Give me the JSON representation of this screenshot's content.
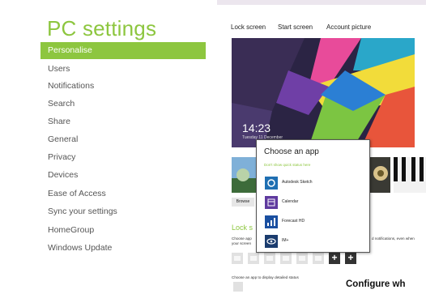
{
  "header": {
    "title": "PC settings"
  },
  "sidebar": {
    "items": [
      {
        "label": "Personalise",
        "selected": true
      },
      {
        "label": "Users"
      },
      {
        "label": "Notifications"
      },
      {
        "label": "Search"
      },
      {
        "label": "Share"
      },
      {
        "label": "General"
      },
      {
        "label": "Privacy"
      },
      {
        "label": "Devices"
      },
      {
        "label": "Ease of Access"
      },
      {
        "label": "Sync your settings"
      },
      {
        "label": "HomeGroup"
      },
      {
        "label": "Windows Update"
      }
    ]
  },
  "tabs": [
    {
      "label": "Lock screen",
      "active": true
    },
    {
      "label": "Start screen"
    },
    {
      "label": "Account picture"
    }
  ],
  "lockscreen": {
    "time": "14:23",
    "date": "Tuesday 11 December",
    "browse_label": "Browse",
    "section_heading": "Lock s",
    "choose_apps_line1": "Choose app",
    "choose_apps_line1_right": "d notifications, even when",
    "choose_apps_line2": "your screen",
    "detailed_status_text": "Choose an app to display detailed status",
    "plus_label": "+"
  },
  "popup": {
    "title": "Choose an app",
    "none_option": "Don't show quick status here",
    "apps": [
      {
        "label": "Autodesk Sketch",
        "icon": "sketch-app-icon",
        "color": "#1f6fb2"
      },
      {
        "label": "Calendar",
        "icon": "calendar-app-icon",
        "color": "#5f3a9f"
      },
      {
        "label": "Forecast HD",
        "icon": "forecast-app-icon",
        "color": "#1a4fa0"
      },
      {
        "label": "IM+",
        "icon": "im-plus-app-icon",
        "color": "#1b3c6e"
      }
    ]
  },
  "footer": {
    "configure_text": "Configure wh"
  },
  "colors": {
    "accent": "#8dc63f"
  }
}
